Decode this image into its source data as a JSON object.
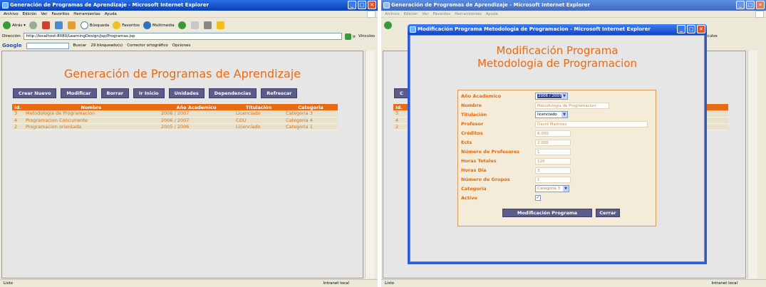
{
  "left": {
    "window_title": "Generación de Programas de Aprendizaje - Microsoft Internet Explorer",
    "menu": [
      "Archivo",
      "Edición",
      "Ver",
      "Favoritos",
      "Herramientas",
      "Ayuda"
    ],
    "toolbar": {
      "back": "Atrás",
      "search": "Búsqueda",
      "favorites": "Favoritos",
      "multimedia": "Multimedia"
    },
    "address_label": "Dirección",
    "address_url": "http://localhost:8080/LearningDesign/jsp/Programas.jsp",
    "go_label": "Ir",
    "links_label": "Vínculos",
    "google": {
      "logo": "Google",
      "search": "Buscar",
      "blocked": "29 bloqueado(s)",
      "spell": "Corrector ortográfico",
      "options": "Opciones"
    },
    "page_title": "Generación de Programas de Aprendizaje",
    "buttons": [
      "Crear Nuevo",
      "Modificar",
      "Borrar",
      "Ir Inicio",
      "Unidades",
      "Dependencias",
      "Refrescar"
    ],
    "table": {
      "headers": [
        "Id.",
        "Nombre",
        "Año Academico",
        "Titulación",
        "Categoria"
      ],
      "rows": [
        [
          "3",
          "Metodologia de Programacion",
          "2006 / 2007",
          "Licenciado",
          "Categoria 3"
        ],
        [
          "4",
          "Programacion Concurrente",
          "2006 / 2007",
          "COU",
          "Categoria 4"
        ],
        [
          "2",
          "Programacion orientada",
          "2005 / 2006",
          "Licenciado",
          "Categoria 1"
        ]
      ]
    },
    "status_left": "Listo",
    "status_zone": "Intranet local"
  },
  "right": {
    "window_title": "Generación de Programas de Aprendizaje - Microsoft Internet Explorer",
    "dialog_title": "Modificación Programa Metodologia de Programacion - Microsoft Internet Explorer",
    "heading_line1": "Modificación Programa",
    "heading_line2": "Metodologia de Programacion",
    "form": {
      "anio_label": "Año Academico",
      "anio_value": "2006 / 2007",
      "nombre_label": "Nombre",
      "nombre_value": "Metodologia de Programacion",
      "titulacion_label": "Titulación",
      "titulacion_value": "licenciado",
      "profesor_label": "Profesor",
      "profesor_value": "David Martinez",
      "creditos_label": "Créditos",
      "creditos_value": "6.000",
      "ects_label": "Ects",
      "ects_value": "2.000",
      "num_prof_label": "Número de Profesores",
      "num_prof_value": "1",
      "horas_tot_label": "Horas Totales",
      "horas_tot_value": "120",
      "horas_dia_label": "Horas Día",
      "horas_dia_value": "3",
      "num_grupos_label": "Número de Grupos",
      "num_grupos_value": "1",
      "categoria_label": "Categoria",
      "categoria_value": "Categoria 3",
      "activo_label": "Activo",
      "activo_checked": true
    },
    "submit_label": "Modificación Programa",
    "cancel_label": "Cerrar",
    "status_left": "Listo",
    "status_zone": "Intranet local"
  }
}
